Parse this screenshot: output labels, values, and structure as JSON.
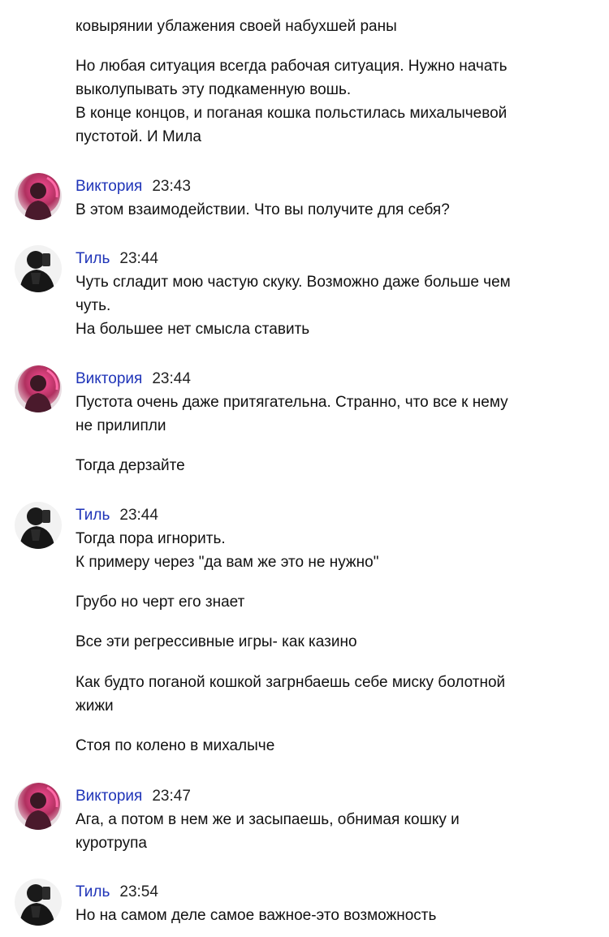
{
  "messages": [
    {
      "lines": [
        "ковырянии ублажения своей набухшей раны",
        "Но любая ситуация всегда рабочая ситуация. Нужно начать\nвыколупывать эту подкаменную вошь.\nВ конце концов, и поганая кошка польстилась михалычевой\nпустотой. И Мила"
      ]
    },
    {
      "author": "Виктория",
      "time": "23:43",
      "avatar": "viktoria-avatar",
      "lines": [
        "В этом взаимодействии. Что вы получите для себя?"
      ]
    },
    {
      "author": "Тиль",
      "time": "23:44",
      "avatar": "til-avatar",
      "lines": [
        "Чуть сгладит мою частую скуку. Возможно даже больше чем\nчуть.\nНа большее нет смысла ставить"
      ]
    },
    {
      "author": "Виктория",
      "time": "23:44",
      "avatar": "viktoria-avatar",
      "lines": [
        "Пустота очень даже притягательна. Странно, что все к нему\nне прилипли",
        "Тогда дерзайте"
      ]
    },
    {
      "author": "Тиль",
      "time": "23:44",
      "avatar": "til-avatar",
      "lines": [
        "Тогда пора игнорить.\nК примеру через \"да вам же это не нужно\"",
        "Грубо но черт его знает",
        "Все эти регрессивные игры- как казино",
        "Как будто поганой кошкой загрнбаешь себе миску болотной\nжижи",
        "Стоя по колено в михалыче"
      ]
    },
    {
      "author": "Виктория",
      "time": "23:47",
      "avatar": "viktoria-avatar",
      "lines": [
        "Ага, а потом в нем же и засыпаешь, обнимая кошку и\nкуротрупа"
      ]
    },
    {
      "author": "Тиль",
      "time": "23:54",
      "avatar": "til-avatar",
      "lines": [
        "Но на самом деле самое важное-это возможность"
      ]
    }
  ],
  "colors": {
    "author": "#1f34b8",
    "text": "#111111",
    "background": "#ffffff"
  }
}
